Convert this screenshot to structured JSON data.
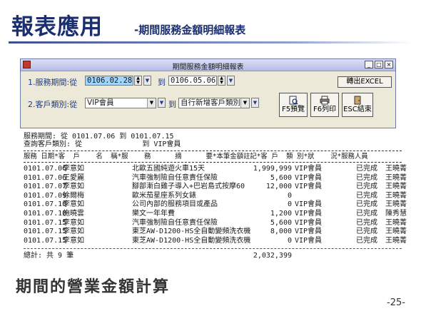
{
  "slide": {
    "title": "報表應用",
    "subtitle": "-期間服務金額明細報表",
    "summary_text": "期間的營業金額計算",
    "page_number": "-25-"
  },
  "window": {
    "title": "期間服務金額明細報表",
    "min_glyph": "_",
    "max_glyph": "□",
    "close_glyph": "×"
  },
  "form": {
    "period_label": "1.服務期間:從",
    "period_from": "0106.02.28",
    "to_label": "到",
    "period_to": "0106.05.06",
    "customer_label": "2.客戶類別:從",
    "customer_from": "VIP會員",
    "customer_to_label": "到",
    "customer_to": "自行新增客戶類別",
    "export_button": "轉出EXCEL",
    "preview_button": "F5預覽",
    "print_button": "F6列印",
    "exit_button": "ESC結束"
  },
  "report": {
    "period_line": "服務期間: 從 0101.07.06 到 0101.07.15",
    "query_line": "查詢客戶類別: 從              到 VIP會員",
    "header_line": "服務 日期*客  戶    名  稱*服    務      摘      要*本筆金額註記*客 戶  類 別*狀    況*服務人員",
    "rows": [
      {
        "date": "0101.07.06",
        "customer": "李意如",
        "desc": "北歐五國純遊火車15天",
        "amount": "1,999,999",
        "note": "VIP會員",
        "status": "已完成",
        "staff": "王曉菁"
      },
      {
        "date": "0101.07.06",
        "customer": "王愛麗",
        "desc": "汽車強制險自任意責任保險",
        "amount": "5,600",
        "note": "VIP會員",
        "status": "已完成",
        "staff": "王曉菁"
      },
      {
        "date": "0101.07.07",
        "customer": "李意如",
        "desc": "腳部漸白雞子導入+巴岩島式按摩60",
        "amount": "12,000",
        "note": "VIP會員",
        "status": "已完成",
        "staff": "王曉菁"
      },
      {
        "date": "0101.07.09",
        "customer": "徐爾梅",
        "desc": "歐米茄星座系列女錶",
        "amount": "0",
        "note": "",
        "status": "已完成",
        "staff": "王曉菁"
      },
      {
        "date": "0101.07.10",
        "customer": "李意如",
        "desc": "公司內部的服務項目或產品",
        "amount": "0",
        "note": "VIP會員",
        "status": "已完成",
        "staff": "王曉菁"
      },
      {
        "date": "0101.07.10",
        "customer": "施曉雲",
        "desc": "樂文一年年費",
        "amount": "1,200",
        "note": "VIP會員",
        "status": "已完成",
        "staff": "陳秀慧"
      },
      {
        "date": "0101.07.15",
        "customer": "李意如",
        "desc": "汽車強制險自任意責任保險",
        "amount": "5,600",
        "note": "VIP會員",
        "status": "已完成",
        "staff": "王曉菁"
      },
      {
        "date": "0101.07.15",
        "customer": "李意如",
        "desc": "東芝AW-D1200-HS全自動變頻洗衣機",
        "amount": "8,000",
        "note": "VIP會員",
        "status": "已完成",
        "staff": "王曉菁"
      },
      {
        "date": "0101.07.15",
        "customer": "李意如",
        "desc": "東芝AW-D1200-HS全自動變頻洗衣機",
        "amount": "0",
        "note": "VIP會員",
        "status": "已完成",
        "staff": "王曉菁"
      }
    ],
    "total_label": "總計: 共 9 筆",
    "total_amount": "2,032,399"
  },
  "colors": {
    "title": "#1b2f6e",
    "label_text": "#1f3b86",
    "dialog_bg": "#ece9d8",
    "selected_field": "#9fd5ff"
  }
}
